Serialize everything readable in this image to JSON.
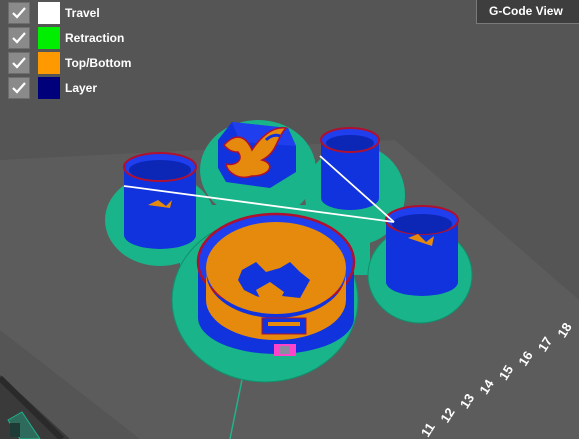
{
  "window": {
    "view_mode_button": "G-Code View"
  },
  "legend": {
    "items": [
      {
        "label": "Travel",
        "checked": true,
        "color": "#ffffff",
        "icon": "checkmark-icon"
      },
      {
        "label": "Retraction",
        "checked": true,
        "color": "#00ee00",
        "icon": "checkmark-icon"
      },
      {
        "label": "Top/Bottom",
        "checked": true,
        "color": "#ff9900",
        "icon": "checkmark-icon"
      },
      {
        "label": "Layer",
        "checked": true,
        "color": "#00007a",
        "icon": "checkmark-icon"
      }
    ]
  },
  "layer_slider": {
    "visible_labels": [
      "11",
      "12",
      "13",
      "14",
      "15",
      "16",
      "17",
      "18"
    ]
  },
  "colors": {
    "viewport_background": "#555555",
    "build_plate": "#6a6a6a",
    "skirt": "#19b489",
    "wall": "#1133dd",
    "top_bottom": "#e58a0c",
    "outer_wall": "#b01030",
    "travel": "#ffffff",
    "retraction_marker": "#ff44cc"
  }
}
